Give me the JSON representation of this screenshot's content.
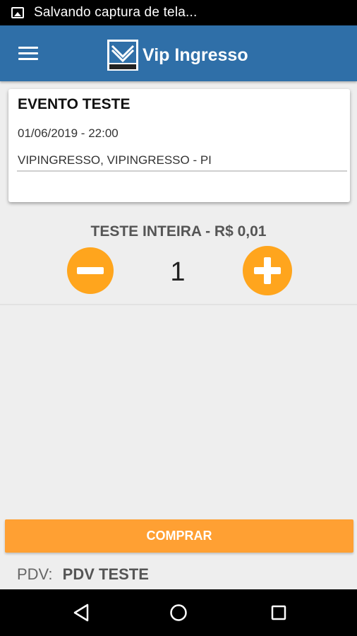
{
  "status_bar": {
    "notification_text": "Salvando captura de tela...",
    "icon": "image-icon"
  },
  "app_bar": {
    "title": "Vip Ingresso",
    "menu_icon": "hamburger-menu-icon",
    "brand_color": "#2f6fa8"
  },
  "event": {
    "title": "EVENTO TESTE",
    "datetime": "01/06/2019 - 22:00",
    "location": "VIPINGRESSO, VIPINGRESSO - PI"
  },
  "ticket": {
    "name": "TESTE INTEIRA - R$ 0,01",
    "quantity": "1",
    "accent_color": "#ffa51d"
  },
  "actions": {
    "buy_label": "COMPRAR"
  },
  "footer": {
    "pdv_label": "PDV:",
    "pdv_value": "PDV TESTE"
  },
  "nav_bar": {
    "icons": [
      "back-icon",
      "home-icon",
      "recents-icon"
    ]
  }
}
